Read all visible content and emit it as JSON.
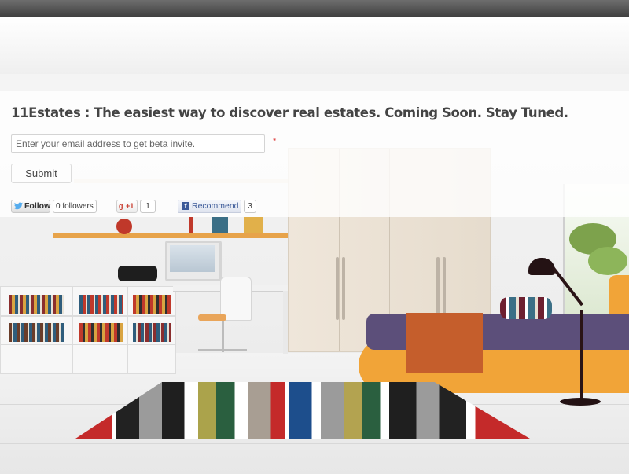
{
  "headline": "11Estates : The easiest way to discover real estates. Coming Soon. Stay Tuned.",
  "signup": {
    "email_placeholder": "Enter your email address to get beta invite.",
    "email_value": "",
    "required_mark": "*",
    "submit_label": "Submit"
  },
  "social": {
    "twitter": {
      "label": "Follow",
      "count": "0 followers",
      "icon": "twitter-bird-icon"
    },
    "google_plus": {
      "g": "g",
      "label": "+1",
      "count": "1",
      "icon": "google-plus-icon"
    },
    "facebook": {
      "f": "f",
      "label": "Recommend",
      "count": "3",
      "icon": "facebook-icon"
    }
  },
  "colors": {
    "topbar": "#4a4a4a",
    "headline_text": "#444444",
    "twitter_blue": "#55acee",
    "facebook_blue": "#3b5998",
    "google_red": "#c9392b"
  }
}
